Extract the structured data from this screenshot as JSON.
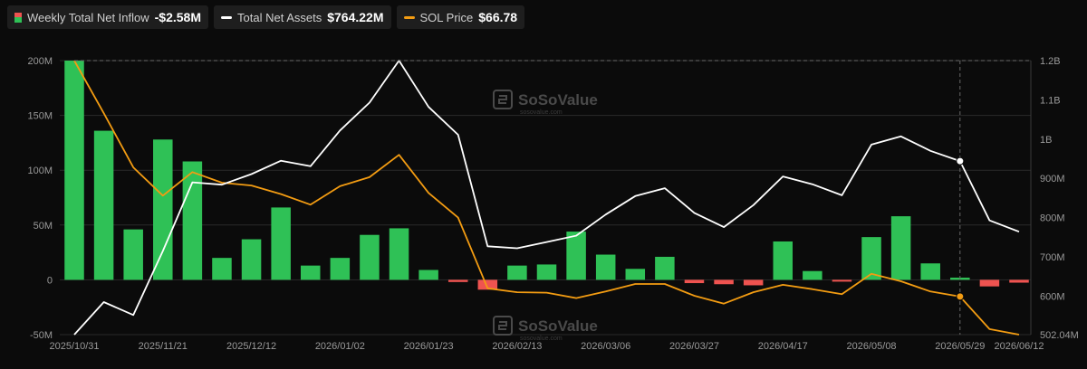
{
  "legend": {
    "inflow_label": "Weekly Total Net Inflow",
    "inflow_value": "-$2.58M",
    "assets_label": "Total Net Assets",
    "assets_value": "$764.22M",
    "price_label": "SOL Price",
    "price_value": "$66.78"
  },
  "watermark": {
    "brand": "SoSoValue",
    "sub": "sosovalue.com"
  },
  "colors": {
    "inflow_positive": "#2fc156",
    "inflow_negative": "#ef5350",
    "assets_line": "#ffffff",
    "price_line": "#f39c12",
    "grid": "#2a2a2a",
    "crosshair": "#6a6a6a"
  },
  "chart_data": {
    "type": "bar",
    "grid": true,
    "legend_position": "top-left",
    "x_tick_labels": [
      "2025/10/31",
      "2025/11/21",
      "2025/12/12",
      "2026/01/02",
      "2026/01/23",
      "2026/02/13",
      "2026/03/06",
      "2026/03/27",
      "2026/04/17",
      "2026/05/08",
      "2026/05/29",
      "2026/06/12"
    ],
    "left_axis": {
      "ticks": [
        "200M",
        "150M",
        "100M",
        "50M",
        "0",
        "-50M"
      ],
      "ylim": [
        -50,
        200
      ],
      "unit": "M"
    },
    "right_axis": {
      "ticks": [
        "1.2B",
        "1.1B",
        "1B",
        "900M",
        "800M",
        "700M",
        "600M",
        "502.04M"
      ],
      "ylim": [
        502.04,
        1200
      ],
      "unit": "M"
    },
    "x": [
      "2025/10/31",
      "2025/11/07",
      "2025/11/14",
      "2025/11/21",
      "2025/11/28",
      "2025/12/05",
      "2025/12/12",
      "2025/12/19",
      "2025/12/26",
      "2026/01/02",
      "2026/01/09",
      "2026/01/16",
      "2026/01/23",
      "2026/01/30",
      "2026/02/06",
      "2026/02/13",
      "2026/02/20",
      "2026/02/27",
      "2026/03/06",
      "2026/03/13",
      "2026/03/20",
      "2026/03/27",
      "2026/04/03",
      "2026/04/10",
      "2026/04/17",
      "2026/04/24",
      "2026/05/01",
      "2026/05/08",
      "2026/05/15",
      "2026/05/22",
      "2026/05/29",
      "2026/06/05",
      "2026/06/12"
    ],
    "series": [
      {
        "name": "Weekly Total Net Inflow",
        "axis": "left",
        "type": "bar",
        "values": [
          200,
          136,
          46,
          128,
          108,
          20,
          37,
          66,
          13,
          20,
          41,
          47,
          9,
          -2,
          -9,
          13,
          14,
          44,
          23,
          10,
          21,
          -3,
          -4,
          -5,
          35,
          8,
          -1,
          39,
          58,
          15,
          2,
          -6,
          -2.58
        ]
      },
      {
        "name": "Total Net Assets",
        "axis": "right",
        "type": "line",
        "values": [
          502,
          585,
          552,
          715,
          890,
          884,
          911,
          945,
          931,
          1022,
          1093,
          1200,
          1082,
          1011,
          727,
          722,
          738,
          754,
          808,
          855,
          875,
          812,
          776,
          832,
          905,
          885,
          857,
          986,
          1007,
          970,
          944,
          793,
          764.22
        ]
      },
      {
        "name": "SOL Price",
        "axis": "right",
        "type": "line",
        "values": [
          1200,
          1066,
          928,
          856,
          916,
          889,
          882,
          860,
          833,
          880,
          903,
          960,
          863,
          800,
          620,
          610,
          609,
          595,
          612,
          631,
          631,
          601,
          581,
          610,
          629,
          618,
          605,
          657,
          638,
          612,
          599,
          516,
          502.04
        ]
      }
    ],
    "highlight_index": 30
  }
}
